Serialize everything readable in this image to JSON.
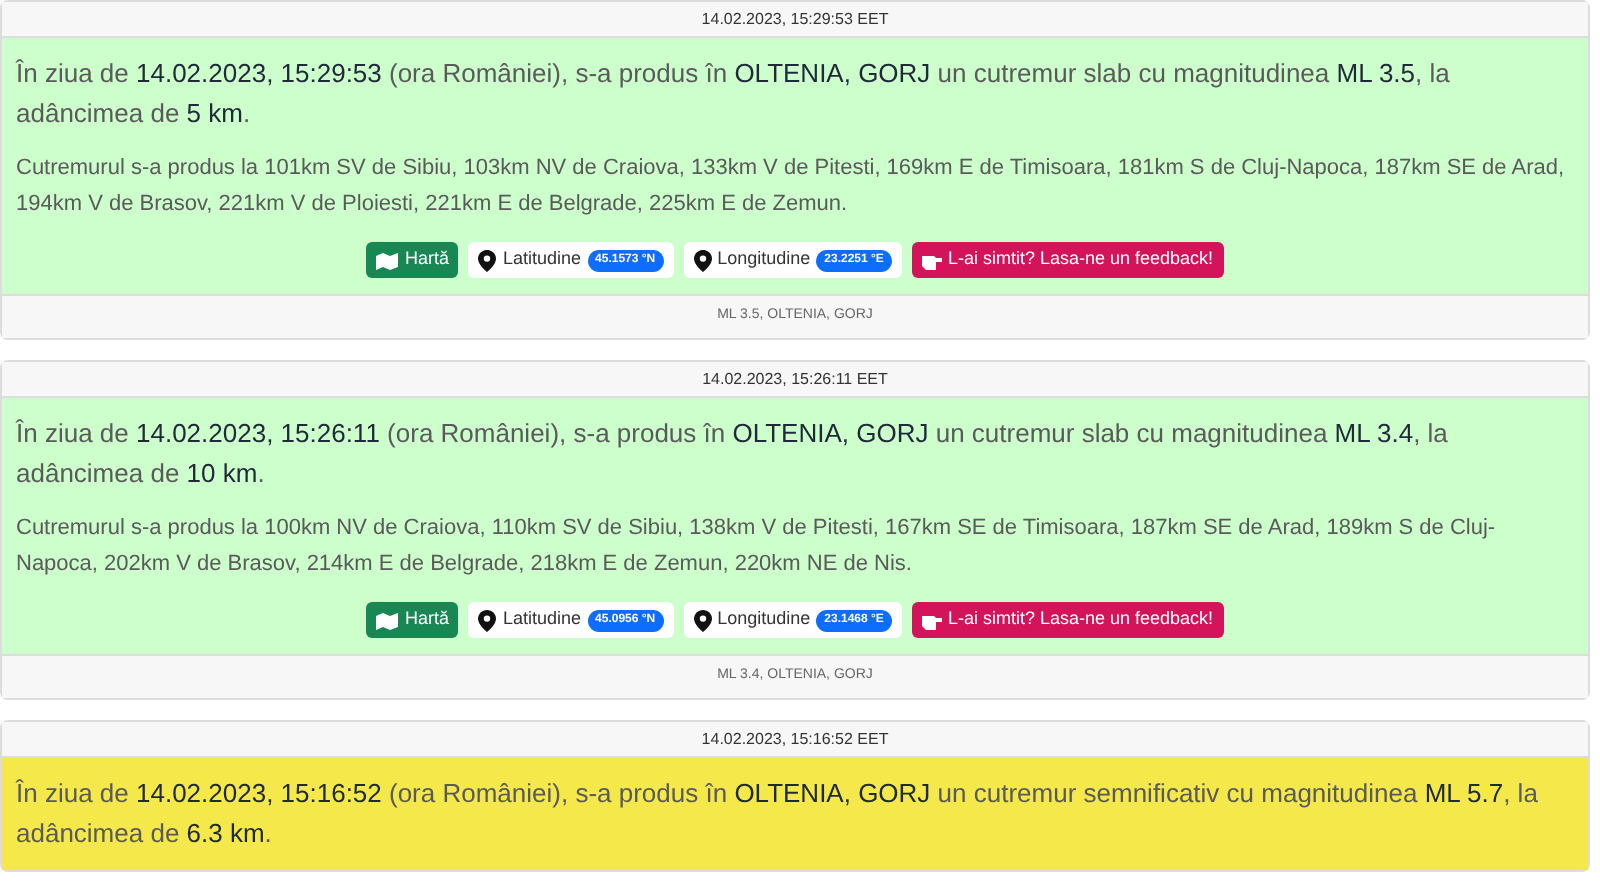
{
  "events": [
    {
      "header": "14.02.2023, 15:29:53 EET",
      "color": "#ccffcc",
      "summary": "În ziua de **14.02.2023, 15:29:53** (ora României), s-a produs în **OLTENIA, GORJ** un cutremur slab cu magnitudinea **ML 3.5**, la adâncimea de **5 km**.",
      "details": "Cutremurul s-a produs la 101km SV de Sibiu, 103km NV de Craiova, 133km V de Pitesti, 169km E de Timisoara, 181km S de Cluj-Napoca, 187km SE de Arad, 194km V de Brasov, 221km V de Ploiesti, 221km E de Belgrade, 225km E de Zemun.",
      "map_button": "Hartă",
      "latitude_label": "Latitudine",
      "latitude": "45.1573 °N",
      "longitude_label": "Longitudine",
      "longitude": "23.2251 °E",
      "feedback_button": "L-ai simtit? Lasa-ne un feedback!",
      "footer": "ML 3.5, OLTENIA, GORJ"
    },
    {
      "header": "14.02.2023, 15:26:11 EET",
      "color": "#ccffcc",
      "summary": "În ziua de **14.02.2023, 15:26:11** (ora României), s-a produs în **OLTENIA, GORJ** un cutremur slab cu magnitudinea **ML 3.4**, la adâncimea de **10 km**.",
      "details": "Cutremurul s-a produs la 100km NV de Craiova, 110km SV de Sibiu, 138km V de Pitesti, 167km SE de Timisoara, 187km SE de Arad, 189km S de Cluj-Napoca, 202km V de Brasov, 214km E de Belgrade, 218km E de Zemun, 220km NE de Nis.",
      "map_button": "Hartă",
      "latitude_label": "Latitudine",
      "latitude": "45.0956 °N",
      "longitude_label": "Longitudine",
      "longitude": "23.1468 °E",
      "feedback_button": "L-ai simtit? Lasa-ne un feedback!",
      "footer": "ML 3.4, OLTENIA, GORJ"
    },
    {
      "header": "14.02.2023, 15:16:52 EET",
      "color": "#f5e84a",
      "summary": "În ziua de **14.02.2023, 15:16:52** (ora României), s-a produs în **OLTENIA, GORJ** un cutremur semnificativ cu magnitudinea **ML 5.7**, la adâncimea de **6.3 km**."
    }
  ]
}
